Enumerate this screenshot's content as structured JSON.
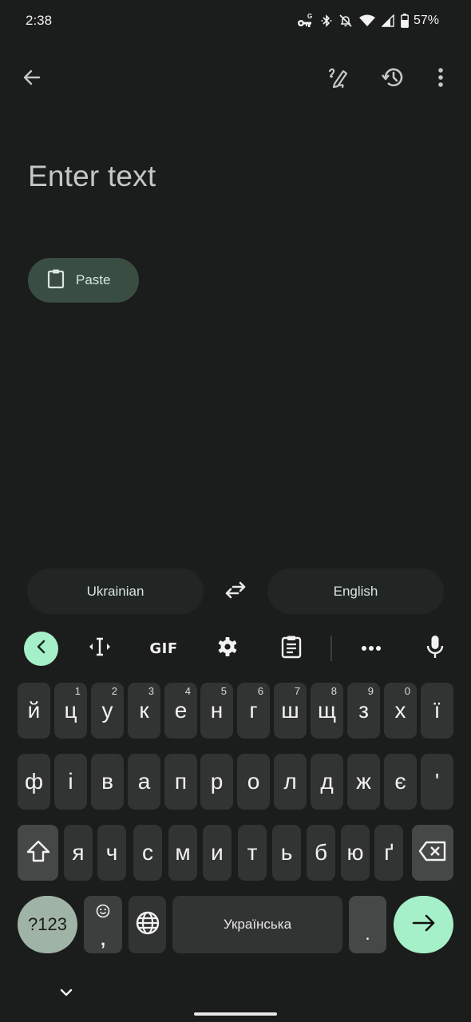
{
  "status_bar": {
    "time": "2:38",
    "icons": [
      "vpn-key-icon",
      "bluetooth-icon",
      "notifications-off-icon",
      "wifi-icon",
      "cell-signal-icon",
      "battery-icon"
    ],
    "battery_percent": "57%",
    "battery_level": 0.57
  },
  "app_bar": {
    "back_icon": "arrow-back-icon",
    "actions": [
      "handwriting-icon",
      "history-icon",
      "more-vert-icon"
    ]
  },
  "input": {
    "placeholder": "Enter text"
  },
  "paste_chip": {
    "icon": "clipboard-icon",
    "label": "Paste"
  },
  "language_bar": {
    "source": "Ukrainian",
    "target": "English",
    "swap_icon": "swap-horizontal-icon"
  },
  "keyboard_toolbar": {
    "items": [
      "collapse-left-icon",
      "cursor-control-icon",
      "GIF",
      "settings-icon",
      "clipboard-icon",
      "more-horiz-icon",
      "mic-icon"
    ],
    "gif_label": "GIF",
    "accent": "#a5f0c9"
  },
  "keyboard": {
    "row1": [
      {
        "ch": "й",
        "hint": ""
      },
      {
        "ch": "ц",
        "hint": "1"
      },
      {
        "ch": "у",
        "hint": "2"
      },
      {
        "ch": "к",
        "hint": "3"
      },
      {
        "ch": "е",
        "hint": "4"
      },
      {
        "ch": "н",
        "hint": "5"
      },
      {
        "ch": "г",
        "hint": "6"
      },
      {
        "ch": "ш",
        "hint": "7"
      },
      {
        "ch": "щ",
        "hint": "8"
      },
      {
        "ch": "з",
        "hint": "9"
      },
      {
        "ch": "х",
        "hint": "0"
      },
      {
        "ch": "ї",
        "hint": ""
      }
    ],
    "row2": [
      "ф",
      "і",
      "в",
      "а",
      "п",
      "р",
      "о",
      "л",
      "д",
      "ж",
      "є",
      "'"
    ],
    "row3": [
      "я",
      "ч",
      "с",
      "м",
      "и",
      "т",
      "ь",
      "б",
      "ю",
      "ґ"
    ],
    "symbols_label": "?123",
    "comma_label": ",",
    "space_label": "Українська",
    "period_label": ".",
    "enter_icon": "arrow-forward-icon",
    "shift_icon": "shift-icon",
    "backspace_icon": "backspace-icon",
    "globe_icon": "globe-icon",
    "emoji_icon": "emoji-icon"
  },
  "nav": {
    "collapse_icon": "chevron-down-icon"
  }
}
